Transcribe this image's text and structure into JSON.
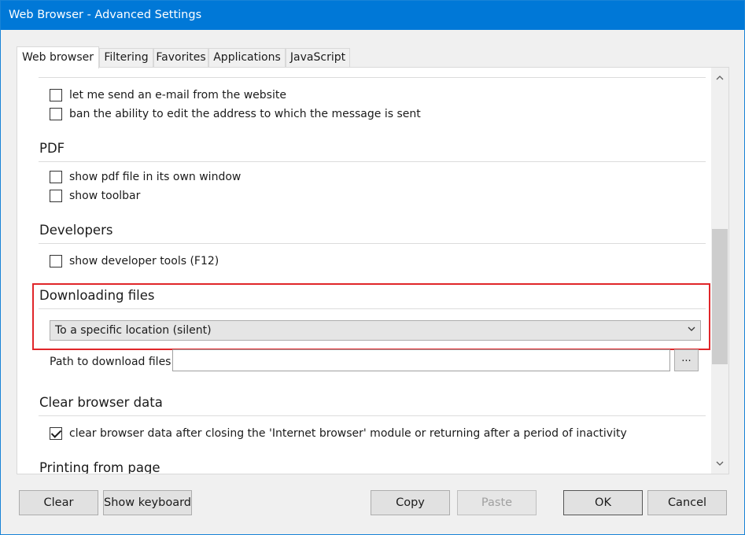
{
  "window": {
    "title": "Web Browser - Advanced Settings",
    "accent": "#0078d7"
  },
  "tabs": [
    {
      "label": "Web browser",
      "active": true
    },
    {
      "label": "Filtering",
      "active": false
    },
    {
      "label": "Favorites",
      "active": false
    },
    {
      "label": "Applications",
      "active": false
    },
    {
      "label": "JavaScript",
      "active": false
    }
  ],
  "email": {
    "options": [
      {
        "label": "let me send an e-mail from the website",
        "checked": false
      },
      {
        "label": "ban the ability to edit the address to which the message is sent",
        "checked": false
      }
    ]
  },
  "pdf": {
    "title": "PDF",
    "options": [
      {
        "label": "show pdf file in its own window",
        "checked": false
      },
      {
        "label": "show toolbar",
        "checked": false
      }
    ]
  },
  "developers": {
    "title": "Developers",
    "options": [
      {
        "label": "show developer tools (F12)",
        "checked": false
      }
    ]
  },
  "downloading": {
    "title": "Downloading files",
    "selected": "To a specific location (silent)",
    "path_label": "Path to download files:",
    "path_value": "",
    "browse_label": "...",
    "highlight_color": "#e0262a"
  },
  "clear_data": {
    "title": "Clear browser data",
    "options": [
      {
        "label": "clear browser data after closing the 'Internet browser' module or returning after a period of inactivity",
        "checked": true
      }
    ]
  },
  "printing": {
    "title": "Printing from page"
  },
  "buttons": {
    "clear": "Clear",
    "show_keyboard": "Show keyboard",
    "copy": "Copy",
    "paste": "Paste",
    "ok": "OK",
    "cancel": "Cancel"
  }
}
